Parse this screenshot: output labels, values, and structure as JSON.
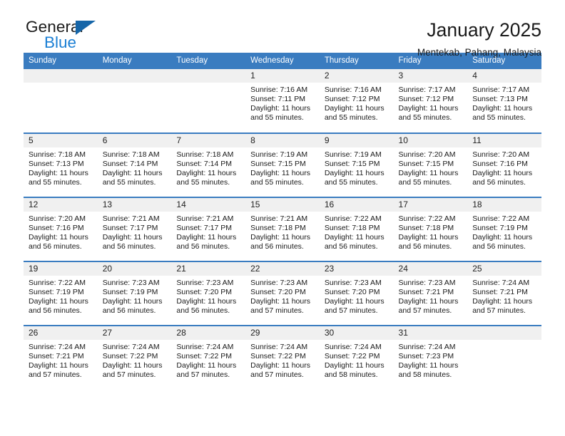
{
  "brand": {
    "name_top": "General",
    "name_bottom": "Blue",
    "accent_color": "#1b7fd4",
    "triangle_color": "#1565a8",
    "logo_icon": "triangle-logo-icon"
  },
  "header": {
    "title": "January 2025",
    "subtitle": "Mentekab, Pahang, Malaysia"
  },
  "calendar": {
    "header_bg": "#3a7cc0",
    "daynum_bg": "#f0f0f0",
    "weekday_headers": [
      "Sunday",
      "Monday",
      "Tuesday",
      "Wednesday",
      "Thursday",
      "Friday",
      "Saturday"
    ],
    "weeks": [
      [
        {
          "day": "",
          "lines": []
        },
        {
          "day": "",
          "lines": []
        },
        {
          "day": "",
          "lines": []
        },
        {
          "day": "1",
          "lines": [
            "Sunrise: 7:16 AM",
            "Sunset: 7:11 PM",
            "Daylight: 11 hours",
            "and 55 minutes."
          ]
        },
        {
          "day": "2",
          "lines": [
            "Sunrise: 7:16 AM",
            "Sunset: 7:12 PM",
            "Daylight: 11 hours",
            "and 55 minutes."
          ]
        },
        {
          "day": "3",
          "lines": [
            "Sunrise: 7:17 AM",
            "Sunset: 7:12 PM",
            "Daylight: 11 hours",
            "and 55 minutes."
          ]
        },
        {
          "day": "4",
          "lines": [
            "Sunrise: 7:17 AM",
            "Sunset: 7:13 PM",
            "Daylight: 11 hours",
            "and 55 minutes."
          ]
        }
      ],
      [
        {
          "day": "5",
          "lines": [
            "Sunrise: 7:18 AM",
            "Sunset: 7:13 PM",
            "Daylight: 11 hours",
            "and 55 minutes."
          ]
        },
        {
          "day": "6",
          "lines": [
            "Sunrise: 7:18 AM",
            "Sunset: 7:14 PM",
            "Daylight: 11 hours",
            "and 55 minutes."
          ]
        },
        {
          "day": "7",
          "lines": [
            "Sunrise: 7:18 AM",
            "Sunset: 7:14 PM",
            "Daylight: 11 hours",
            "and 55 minutes."
          ]
        },
        {
          "day": "8",
          "lines": [
            "Sunrise: 7:19 AM",
            "Sunset: 7:15 PM",
            "Daylight: 11 hours",
            "and 55 minutes."
          ]
        },
        {
          "day": "9",
          "lines": [
            "Sunrise: 7:19 AM",
            "Sunset: 7:15 PM",
            "Daylight: 11 hours",
            "and 55 minutes."
          ]
        },
        {
          "day": "10",
          "lines": [
            "Sunrise: 7:20 AM",
            "Sunset: 7:15 PM",
            "Daylight: 11 hours",
            "and 55 minutes."
          ]
        },
        {
          "day": "11",
          "lines": [
            "Sunrise: 7:20 AM",
            "Sunset: 7:16 PM",
            "Daylight: 11 hours",
            "and 56 minutes."
          ]
        }
      ],
      [
        {
          "day": "12",
          "lines": [
            "Sunrise: 7:20 AM",
            "Sunset: 7:16 PM",
            "Daylight: 11 hours",
            "and 56 minutes."
          ]
        },
        {
          "day": "13",
          "lines": [
            "Sunrise: 7:21 AM",
            "Sunset: 7:17 PM",
            "Daylight: 11 hours",
            "and 56 minutes."
          ]
        },
        {
          "day": "14",
          "lines": [
            "Sunrise: 7:21 AM",
            "Sunset: 7:17 PM",
            "Daylight: 11 hours",
            "and 56 minutes."
          ]
        },
        {
          "day": "15",
          "lines": [
            "Sunrise: 7:21 AM",
            "Sunset: 7:18 PM",
            "Daylight: 11 hours",
            "and 56 minutes."
          ]
        },
        {
          "day": "16",
          "lines": [
            "Sunrise: 7:22 AM",
            "Sunset: 7:18 PM",
            "Daylight: 11 hours",
            "and 56 minutes."
          ]
        },
        {
          "day": "17",
          "lines": [
            "Sunrise: 7:22 AM",
            "Sunset: 7:18 PM",
            "Daylight: 11 hours",
            "and 56 minutes."
          ]
        },
        {
          "day": "18",
          "lines": [
            "Sunrise: 7:22 AM",
            "Sunset: 7:19 PM",
            "Daylight: 11 hours",
            "and 56 minutes."
          ]
        }
      ],
      [
        {
          "day": "19",
          "lines": [
            "Sunrise: 7:22 AM",
            "Sunset: 7:19 PM",
            "Daylight: 11 hours",
            "and 56 minutes."
          ]
        },
        {
          "day": "20",
          "lines": [
            "Sunrise: 7:23 AM",
            "Sunset: 7:19 PM",
            "Daylight: 11 hours",
            "and 56 minutes."
          ]
        },
        {
          "day": "21",
          "lines": [
            "Sunrise: 7:23 AM",
            "Sunset: 7:20 PM",
            "Daylight: 11 hours",
            "and 56 minutes."
          ]
        },
        {
          "day": "22",
          "lines": [
            "Sunrise: 7:23 AM",
            "Sunset: 7:20 PM",
            "Daylight: 11 hours",
            "and 57 minutes."
          ]
        },
        {
          "day": "23",
          "lines": [
            "Sunrise: 7:23 AM",
            "Sunset: 7:20 PM",
            "Daylight: 11 hours",
            "and 57 minutes."
          ]
        },
        {
          "day": "24",
          "lines": [
            "Sunrise: 7:23 AM",
            "Sunset: 7:21 PM",
            "Daylight: 11 hours",
            "and 57 minutes."
          ]
        },
        {
          "day": "25",
          "lines": [
            "Sunrise: 7:24 AM",
            "Sunset: 7:21 PM",
            "Daylight: 11 hours",
            "and 57 minutes."
          ]
        }
      ],
      [
        {
          "day": "26",
          "lines": [
            "Sunrise: 7:24 AM",
            "Sunset: 7:21 PM",
            "Daylight: 11 hours",
            "and 57 minutes."
          ]
        },
        {
          "day": "27",
          "lines": [
            "Sunrise: 7:24 AM",
            "Sunset: 7:22 PM",
            "Daylight: 11 hours",
            "and 57 minutes."
          ]
        },
        {
          "day": "28",
          "lines": [
            "Sunrise: 7:24 AM",
            "Sunset: 7:22 PM",
            "Daylight: 11 hours",
            "and 57 minutes."
          ]
        },
        {
          "day": "29",
          "lines": [
            "Sunrise: 7:24 AM",
            "Sunset: 7:22 PM",
            "Daylight: 11 hours",
            "and 57 minutes."
          ]
        },
        {
          "day": "30",
          "lines": [
            "Sunrise: 7:24 AM",
            "Sunset: 7:22 PM",
            "Daylight: 11 hours",
            "and 58 minutes."
          ]
        },
        {
          "day": "31",
          "lines": [
            "Sunrise: 7:24 AM",
            "Sunset: 7:23 PM",
            "Daylight: 11 hours",
            "and 58 minutes."
          ]
        },
        {
          "day": "",
          "lines": []
        }
      ]
    ]
  }
}
